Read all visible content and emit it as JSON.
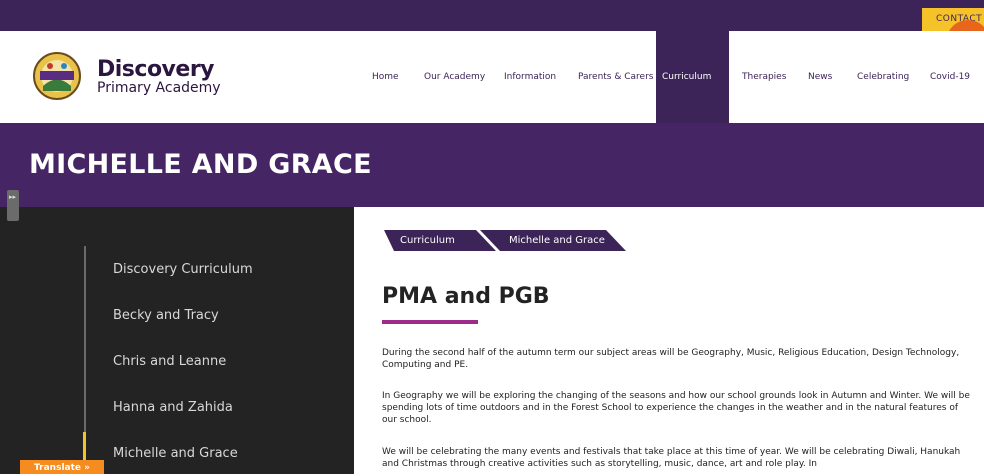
{
  "topbar": {
    "contact_label": "CONTACT",
    "accent": "#f6c22a",
    "brand": "#3d2458"
  },
  "accessibility": {
    "icon": "headphones-icon"
  },
  "logo": {
    "title": "Discovery",
    "subtitle": "Primary Academy",
    "badge_text": "DISCOVERY"
  },
  "nav": {
    "items": [
      {
        "label": "Home"
      },
      {
        "label": "Our Academy"
      },
      {
        "label": "Information"
      },
      {
        "label": "Parents & Carers"
      },
      {
        "label": "Curriculum"
      },
      {
        "label": "Therapies"
      },
      {
        "label": "News"
      },
      {
        "label": "Celebrating"
      },
      {
        "label": "Covid-19"
      }
    ],
    "active": "Curriculum"
  },
  "banner": {
    "title": "MICHELLE AND GRACE"
  },
  "sidebar": {
    "items": [
      {
        "label": "Discovery Curriculum"
      },
      {
        "label": "Becky and Tracy"
      },
      {
        "label": "Chris and Leanne"
      },
      {
        "label": "Hanna and Zahida"
      },
      {
        "label": "Michelle and Grace"
      }
    ],
    "active": "Michelle and Grace",
    "toggle_glyph": "▸▸"
  },
  "translate": {
    "label": "Translate »"
  },
  "breadcrumb": {
    "items": [
      "Curriculum",
      "Michelle and Grace"
    ]
  },
  "content": {
    "heading": "PMA and PGB",
    "paragraphs": [
      "During the second half of the autumn term our subject areas will be Geography, Music, Religious Education, Design Technology, Computing and PE.",
      "In Geography we will be exploring the changing of the seasons and how our school grounds look in Autumn and Winter. We will be spending lots of time outdoors and in the Forest School to experience the changes in the weather and in the natural features of our school.",
      "We will be celebrating the many events and festivals that take place at this time of year. We will be celebrating Diwali, Hanukah and Christmas through creative activities such as storytelling, music, dance, art and role play. In"
    ]
  }
}
